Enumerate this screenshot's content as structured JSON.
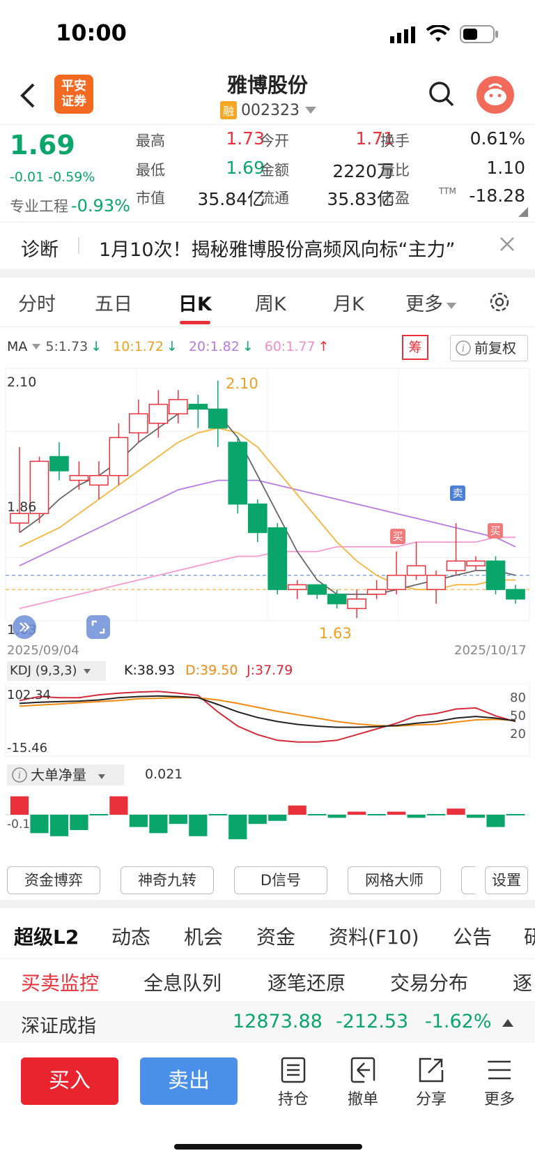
{
  "status": {
    "time": "10:00"
  },
  "header": {
    "title": "雅博股份",
    "code": "002323",
    "margin_badge": "融",
    "broker_logo_line1": "平安",
    "broker_logo_line2": "证券"
  },
  "quote": {
    "price": "1.69",
    "change": "-0.01",
    "change_pct": "-0.59%",
    "sector_label": "专业工程",
    "sector_change": "-0.93%",
    "stats": [
      {
        "label": "最高",
        "value": "1.73",
        "color": "#e8313a"
      },
      {
        "label": "今开",
        "value": "1.71",
        "color": "#e8313a"
      },
      {
        "label": "换手",
        "value": "0.61%",
        "color": "#222"
      },
      {
        "label": "最低",
        "value": "1.69",
        "color": "#0aa56a"
      },
      {
        "label": "金额",
        "value": "2220万",
        "color": "#222"
      },
      {
        "label": "量比",
        "value": "1.10",
        "color": "#222"
      },
      {
        "label": "市值",
        "value": "35.84亿",
        "color": "#222"
      },
      {
        "label": "流通",
        "value": "35.83亿",
        "color": "#222"
      },
      {
        "label": "市盈",
        "value": "-18.28",
        "color": "#222"
      }
    ],
    "ttm": "TTM"
  },
  "diagnosis": {
    "label": "诊断",
    "text": "1月10次！揭秘雅博股份高频风向标“主力”"
  },
  "chart_tabs": [
    "分时",
    "五日",
    "日K",
    "周K",
    "月K",
    "更多"
  ],
  "ma": {
    "label": "MA",
    "items": [
      {
        "text": "5:1.73",
        "arrow": "↓",
        "color": "#555"
      },
      {
        "text": "10:1.72",
        "arrow": "↓",
        "color": "#f0a020"
      },
      {
        "text": "20:1.82",
        "arrow": "↓",
        "color": "#b77be0"
      },
      {
        "text": "60:1.77",
        "arrow": "↑",
        "color": "#f08cc8"
      }
    ],
    "chip_button": "筹",
    "adjust_button": "前复权"
  },
  "kline": {
    "y_high": "2.10",
    "y_mid": "1.86",
    "y_low": "1.63",
    "max_label": "2.10",
    "min_label": "1.63",
    "date_start": "2025/09/04",
    "date_end": "2025/10/17",
    "buy_label": "买",
    "sell_label": "卖"
  },
  "kdj": {
    "label": "KDJ (9,3,3)",
    "k": "K:38.93",
    "d": "D:39.50",
    "j": "J:37.79",
    "y_top": "102.34",
    "y_bottom": "-15.46",
    "levels": [
      "80",
      "50",
      "20"
    ]
  },
  "bigorder": {
    "label": "大单净量",
    "value": "0.021",
    "y_label": "-0.1"
  },
  "tools": [
    "资金博弈",
    "神奇九转",
    "D信号",
    "网格大师",
    "设置"
  ],
  "main_tabs": [
    "超级L2",
    "动态",
    "机会",
    "资金",
    "资料(F10)",
    "公告",
    "研"
  ],
  "sub_tabs": [
    "买卖监控",
    "全息队列",
    "逐笔还原",
    "交易分布",
    "逐"
  ],
  "index": {
    "name": "深证成指",
    "value": "12873.88",
    "change": "-212.53",
    "pct": "-1.62%"
  },
  "actions": {
    "buy": "买入",
    "sell": "卖出",
    "icons": [
      {
        "name": "hold",
        "label": "持仓"
      },
      {
        "name": "cancel",
        "label": "撤单"
      },
      {
        "name": "share",
        "label": "分享"
      },
      {
        "name": "more",
        "label": "更多"
      }
    ]
  },
  "chart_data": {
    "type": "candlestick",
    "x_range": [
      "2025/09/04",
      "2025/10/17"
    ],
    "ylim": [
      1.6,
      2.12
    ],
    "candles": [
      {
        "o": 1.8,
        "c": 1.82,
        "h": 1.96,
        "l": 1.78
      },
      {
        "o": 1.82,
        "c": 1.93,
        "h": 1.94,
        "l": 1.8
      },
      {
        "o": 1.94,
        "c": 1.91,
        "h": 1.97,
        "l": 1.89
      },
      {
        "o": 1.89,
        "c": 1.9,
        "h": 1.93,
        "l": 1.87
      },
      {
        "o": 1.88,
        "c": 1.9,
        "h": 1.93,
        "l": 1.85
      },
      {
        "o": 1.9,
        "c": 1.98,
        "h": 2.01,
        "l": 1.88
      },
      {
        "o": 1.99,
        "c": 2.03,
        "h": 2.06,
        "l": 1.97
      },
      {
        "o": 2.01,
        "c": 2.05,
        "h": 2.08,
        "l": 1.98
      },
      {
        "o": 2.03,
        "c": 2.06,
        "h": 2.08,
        "l": 2.01
      },
      {
        "o": 2.05,
        "c": 2.04,
        "h": 2.07,
        "l": 2.0
      },
      {
        "o": 2.04,
        "c": 2.0,
        "h": 2.1,
        "l": 1.96
      },
      {
        "o": 1.97,
        "c": 1.84,
        "h": 1.98,
        "l": 1.82
      },
      {
        "o": 1.84,
        "c": 1.78,
        "h": 1.85,
        "l": 1.76
      },
      {
        "o": 1.79,
        "c": 1.66,
        "h": 1.8,
        "l": 1.65
      },
      {
        "o": 1.66,
        "c": 1.67,
        "h": 1.68,
        "l": 1.64
      },
      {
        "o": 1.67,
        "c": 1.65,
        "h": 1.67,
        "l": 1.64
      },
      {
        "o": 1.65,
        "c": 1.63,
        "h": 1.66,
        "l": 1.62
      },
      {
        "o": 1.62,
        "c": 1.64,
        "h": 1.66,
        "l": 1.6
      },
      {
        "o": 1.65,
        "c": 1.66,
        "h": 1.68,
        "l": 1.64
      },
      {
        "o": 1.66,
        "c": 1.69,
        "h": 1.74,
        "l": 1.65
      },
      {
        "o": 1.69,
        "c": 1.71,
        "h": 1.76,
        "l": 1.68
      },
      {
        "o": 1.66,
        "c": 1.69,
        "h": 1.7,
        "l": 1.63
      },
      {
        "o": 1.7,
        "c": 1.72,
        "h": 1.8,
        "l": 1.69
      },
      {
        "o": 1.71,
        "c": 1.72,
        "h": 1.73,
        "l": 1.7
      },
      {
        "o": 1.72,
        "c": 1.66,
        "h": 1.73,
        "l": 1.65
      },
      {
        "o": 1.66,
        "c": 1.64,
        "h": 1.67,
        "l": 1.63
      }
    ],
    "ma5": [
      1.78,
      1.81,
      1.85,
      1.88,
      1.9,
      1.93,
      1.97,
      2.0,
      2.03,
      2.05,
      2.03,
      1.98,
      1.9,
      1.82,
      1.74,
      1.68,
      1.65,
      1.65,
      1.65,
      1.66,
      1.67,
      1.68,
      1.69,
      1.7,
      1.7,
      1.69
    ],
    "ma10": [
      1.75,
      1.77,
      1.79,
      1.82,
      1.85,
      1.88,
      1.91,
      1.94,
      1.97,
      1.99,
      2.0,
      1.99,
      1.96,
      1.91,
      1.86,
      1.81,
      1.76,
      1.72,
      1.69,
      1.67,
      1.66,
      1.66,
      1.67,
      1.67,
      1.68,
      1.68
    ],
    "ma20": [
      1.71,
      1.73,
      1.75,
      1.77,
      1.79,
      1.81,
      1.83,
      1.85,
      1.87,
      1.88,
      1.89,
      1.89,
      1.89,
      1.88,
      1.87,
      1.86,
      1.85,
      1.84,
      1.83,
      1.82,
      1.81,
      1.8,
      1.79,
      1.78,
      1.77,
      1.75
    ],
    "ma60": [
      1.62,
      1.63,
      1.64,
      1.65,
      1.66,
      1.67,
      1.68,
      1.69,
      1.7,
      1.71,
      1.72,
      1.73,
      1.73,
      1.74,
      1.74,
      1.74,
      1.75,
      1.75,
      1.75,
      1.75,
      1.76,
      1.76,
      1.76,
      1.76,
      1.77,
      1.77
    ],
    "kdj_k": [
      70,
      72,
      73,
      74,
      76,
      80,
      82,
      83,
      82,
      80,
      68,
      55,
      45,
      38,
      33,
      30,
      28,
      28,
      29,
      31,
      35,
      38,
      44,
      47,
      44,
      39
    ],
    "kdj_d": [
      65,
      67,
      69,
      71,
      73,
      75,
      78,
      79,
      80,
      80,
      76,
      70,
      63,
      56,
      50,
      44,
      38,
      34,
      31,
      30,
      32,
      33,
      37,
      41,
      42,
      40
    ],
    "kdj_j": [
      75,
      82,
      80,
      80,
      85,
      88,
      90,
      91,
      88,
      84,
      55,
      30,
      15,
      5,
      2,
      2,
      5,
      15,
      25,
      35,
      48,
      52,
      60,
      62,
      48,
      38
    ],
    "bigorder": [
      0.06,
      -0.06,
      -0.07,
      -0.05,
      0.0,
      0.06,
      -0.04,
      -0.06,
      -0.03,
      -0.07,
      0.0,
      -0.08,
      -0.03,
      -0.02,
      0.03,
      0.0,
      -0.01,
      0.01,
      0.0,
      0.01,
      -0.01,
      0.0,
      0.02,
      -0.01,
      -0.04,
      0.0
    ]
  }
}
